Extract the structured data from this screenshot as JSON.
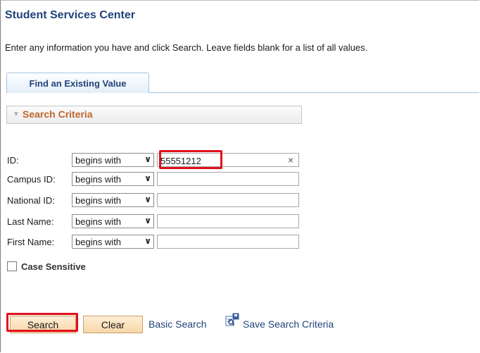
{
  "page": {
    "title": "Student Services Center",
    "instructions": "Enter any information you have and click Search. Leave fields blank for a list of all values."
  },
  "tabs": [
    {
      "label": "Find an Existing Value",
      "active": true
    }
  ],
  "search_criteria": {
    "header": "Search Criteria",
    "fields": [
      {
        "label": "ID:",
        "operator": "begins with",
        "value": "55551212",
        "highlighted": true
      },
      {
        "label": "Campus ID:",
        "operator": "begins with",
        "value": ""
      },
      {
        "label": "National ID:",
        "operator": "begins with",
        "value": ""
      },
      {
        "label": "Last Name:",
        "operator": "begins with",
        "value": ""
      },
      {
        "label": "First Name:",
        "operator": "begins with",
        "value": ""
      }
    ],
    "case_sensitive": {
      "label": "Case Sensitive",
      "checked": false
    }
  },
  "actions": {
    "search": "Search",
    "clear": "Clear",
    "basic_search": "Basic Search",
    "save_search_criteria": "Save Search Criteria"
  },
  "colors": {
    "title": "#22437a",
    "section_label": "#c0652b",
    "highlight": "#e0101b",
    "button": "#f8d7a8"
  },
  "icons": {
    "clear_field": "×",
    "collapse": "triangle-down-icon",
    "save_search": "save-search-icon"
  }
}
